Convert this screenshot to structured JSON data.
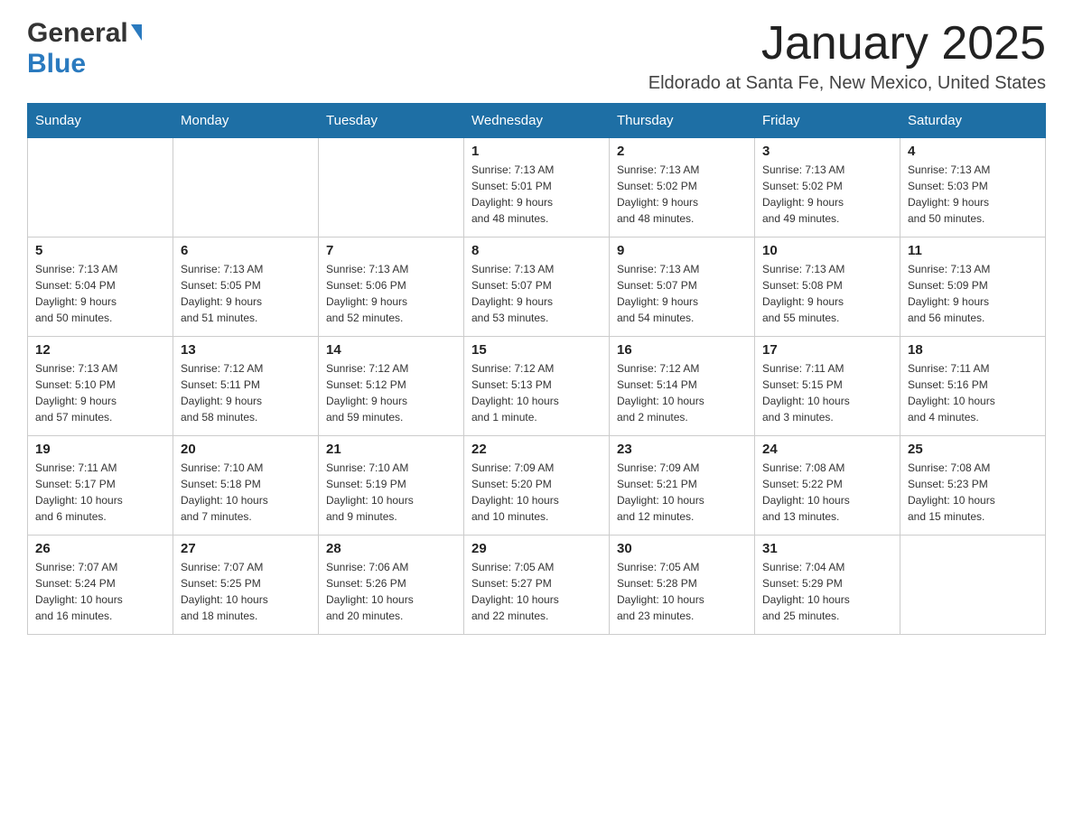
{
  "header": {
    "logo_general": "General",
    "logo_blue": "Blue",
    "month_title": "January 2025",
    "location": "Eldorado at Santa Fe, New Mexico, United States"
  },
  "days_of_week": [
    "Sunday",
    "Monday",
    "Tuesday",
    "Wednesday",
    "Thursday",
    "Friday",
    "Saturday"
  ],
  "weeks": [
    [
      {
        "day": "",
        "info": ""
      },
      {
        "day": "",
        "info": ""
      },
      {
        "day": "",
        "info": ""
      },
      {
        "day": "1",
        "info": "Sunrise: 7:13 AM\nSunset: 5:01 PM\nDaylight: 9 hours\nand 48 minutes."
      },
      {
        "day": "2",
        "info": "Sunrise: 7:13 AM\nSunset: 5:02 PM\nDaylight: 9 hours\nand 48 minutes."
      },
      {
        "day": "3",
        "info": "Sunrise: 7:13 AM\nSunset: 5:02 PM\nDaylight: 9 hours\nand 49 minutes."
      },
      {
        "day": "4",
        "info": "Sunrise: 7:13 AM\nSunset: 5:03 PM\nDaylight: 9 hours\nand 50 minutes."
      }
    ],
    [
      {
        "day": "5",
        "info": "Sunrise: 7:13 AM\nSunset: 5:04 PM\nDaylight: 9 hours\nand 50 minutes."
      },
      {
        "day": "6",
        "info": "Sunrise: 7:13 AM\nSunset: 5:05 PM\nDaylight: 9 hours\nand 51 minutes."
      },
      {
        "day": "7",
        "info": "Sunrise: 7:13 AM\nSunset: 5:06 PM\nDaylight: 9 hours\nand 52 minutes."
      },
      {
        "day": "8",
        "info": "Sunrise: 7:13 AM\nSunset: 5:07 PM\nDaylight: 9 hours\nand 53 minutes."
      },
      {
        "day": "9",
        "info": "Sunrise: 7:13 AM\nSunset: 5:07 PM\nDaylight: 9 hours\nand 54 minutes."
      },
      {
        "day": "10",
        "info": "Sunrise: 7:13 AM\nSunset: 5:08 PM\nDaylight: 9 hours\nand 55 minutes."
      },
      {
        "day": "11",
        "info": "Sunrise: 7:13 AM\nSunset: 5:09 PM\nDaylight: 9 hours\nand 56 minutes."
      }
    ],
    [
      {
        "day": "12",
        "info": "Sunrise: 7:13 AM\nSunset: 5:10 PM\nDaylight: 9 hours\nand 57 minutes."
      },
      {
        "day": "13",
        "info": "Sunrise: 7:12 AM\nSunset: 5:11 PM\nDaylight: 9 hours\nand 58 minutes."
      },
      {
        "day": "14",
        "info": "Sunrise: 7:12 AM\nSunset: 5:12 PM\nDaylight: 9 hours\nand 59 minutes."
      },
      {
        "day": "15",
        "info": "Sunrise: 7:12 AM\nSunset: 5:13 PM\nDaylight: 10 hours\nand 1 minute."
      },
      {
        "day": "16",
        "info": "Sunrise: 7:12 AM\nSunset: 5:14 PM\nDaylight: 10 hours\nand 2 minutes."
      },
      {
        "day": "17",
        "info": "Sunrise: 7:11 AM\nSunset: 5:15 PM\nDaylight: 10 hours\nand 3 minutes."
      },
      {
        "day": "18",
        "info": "Sunrise: 7:11 AM\nSunset: 5:16 PM\nDaylight: 10 hours\nand 4 minutes."
      }
    ],
    [
      {
        "day": "19",
        "info": "Sunrise: 7:11 AM\nSunset: 5:17 PM\nDaylight: 10 hours\nand 6 minutes."
      },
      {
        "day": "20",
        "info": "Sunrise: 7:10 AM\nSunset: 5:18 PM\nDaylight: 10 hours\nand 7 minutes."
      },
      {
        "day": "21",
        "info": "Sunrise: 7:10 AM\nSunset: 5:19 PM\nDaylight: 10 hours\nand 9 minutes."
      },
      {
        "day": "22",
        "info": "Sunrise: 7:09 AM\nSunset: 5:20 PM\nDaylight: 10 hours\nand 10 minutes."
      },
      {
        "day": "23",
        "info": "Sunrise: 7:09 AM\nSunset: 5:21 PM\nDaylight: 10 hours\nand 12 minutes."
      },
      {
        "day": "24",
        "info": "Sunrise: 7:08 AM\nSunset: 5:22 PM\nDaylight: 10 hours\nand 13 minutes."
      },
      {
        "day": "25",
        "info": "Sunrise: 7:08 AM\nSunset: 5:23 PM\nDaylight: 10 hours\nand 15 minutes."
      }
    ],
    [
      {
        "day": "26",
        "info": "Sunrise: 7:07 AM\nSunset: 5:24 PM\nDaylight: 10 hours\nand 16 minutes."
      },
      {
        "day": "27",
        "info": "Sunrise: 7:07 AM\nSunset: 5:25 PM\nDaylight: 10 hours\nand 18 minutes."
      },
      {
        "day": "28",
        "info": "Sunrise: 7:06 AM\nSunset: 5:26 PM\nDaylight: 10 hours\nand 20 minutes."
      },
      {
        "day": "29",
        "info": "Sunrise: 7:05 AM\nSunset: 5:27 PM\nDaylight: 10 hours\nand 22 minutes."
      },
      {
        "day": "30",
        "info": "Sunrise: 7:05 AM\nSunset: 5:28 PM\nDaylight: 10 hours\nand 23 minutes."
      },
      {
        "day": "31",
        "info": "Sunrise: 7:04 AM\nSunset: 5:29 PM\nDaylight: 10 hours\nand 25 minutes."
      },
      {
        "day": "",
        "info": ""
      }
    ]
  ]
}
